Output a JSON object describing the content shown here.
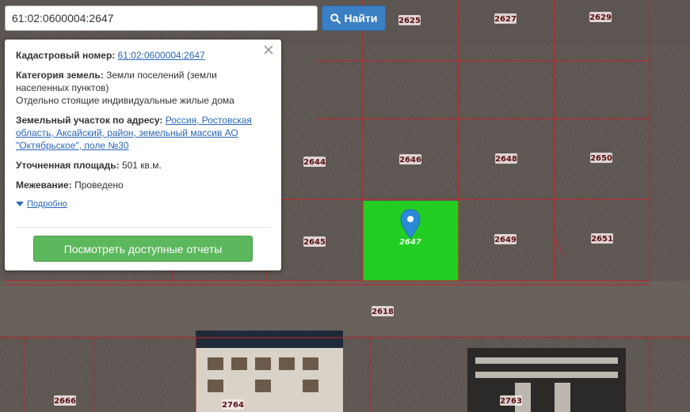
{
  "search": {
    "value": "61:02:0600004:2647",
    "button_label": "Найти"
  },
  "popup": {
    "cadastral_label": "Кадастровый номер:",
    "cadastral_value": "61:02:0600004:2647",
    "category_label": "Категория земель:",
    "category_value": "Земли поселений (земли населенных пунктов)",
    "usage_value": "Отдельно стоящие индивидуальные жилые дома",
    "address_label": "Земельный участок по адресу:",
    "address_value": "Россия, Ростовская область, Аксайский, район, земельный массив АО \"Октябрьское\", поле №30",
    "area_label": "Уточненная площадь:",
    "area_value": "501 кв.м.",
    "survey_label": "Межевание:",
    "survey_value": "Проведено",
    "details_link": "Подробно",
    "reports_button": "Посмотреть доступные отчеты"
  },
  "map": {
    "selected_parcel": "2647",
    "parcels": [
      "2625",
      "2627",
      "2629",
      "2644",
      "2646",
      "2648",
      "2650",
      "2645",
      "2649",
      "2651",
      "2618",
      "2666",
      "2764",
      "2763"
    ],
    "colors": {
      "boundary": "#c8202a",
      "selected_fill": "#1fd41f",
      "marker": "#2a8ad8",
      "label_bg": "#f4eaea",
      "label_text": "#5a1010"
    }
  }
}
